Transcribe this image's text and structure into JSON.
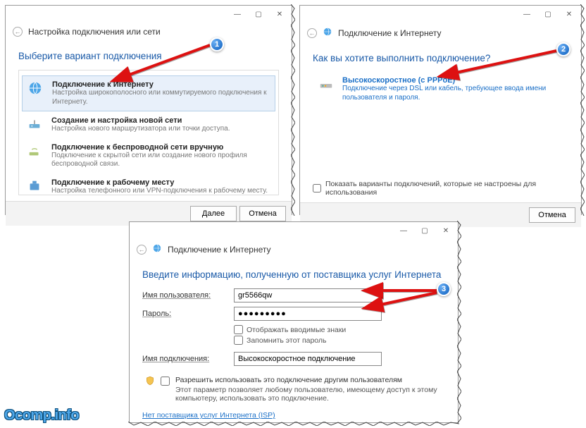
{
  "dialog1": {
    "title": "Настройка подключения или сети",
    "heading": "Выберите вариант подключения",
    "options": [
      {
        "title": "Подключение к Интернету",
        "desc": "Настройка широкополосного или коммутируемого подключения к Интернету."
      },
      {
        "title": "Создание и настройка новой сети",
        "desc": "Настройка нового маршрутизатора или точки доступа."
      },
      {
        "title": "Подключение к беспроводной сети вручную",
        "desc": "Подключение к скрытой сети или создание нового профиля беспроводной связи."
      },
      {
        "title": "Подключение к рабочему месту",
        "desc": "Настройка телефонного или VPN-подключения к рабочему месту."
      }
    ],
    "btn_next": "Далее",
    "btn_cancel": "Отмена"
  },
  "dialog2": {
    "title": "Подключение к Интернету",
    "heading": "Как вы хотите выполнить подключение?",
    "option_title": "Высокоскоростное (с PPPoE)",
    "option_desc": "Подключение через DSL или кабель, требующее ввода имени пользователя и пароля.",
    "show_all": "Показать варианты подключений, которые не настроены для использования",
    "btn_cancel": "Отмена"
  },
  "dialog3": {
    "title": "Подключение к Интернету",
    "heading": "Введите информацию, полученную от поставщика услуг Интернета",
    "label_user": "Имя пользователя:",
    "label_pass": "Пароль:",
    "label_conn": "Имя подключения:",
    "val_user": "gr5566qw",
    "val_pass": "●●●●●●●●●",
    "val_conn": "Высокоскоростное подключение",
    "chk_show": "Отображать вводимые знаки",
    "chk_remember": "Запомнить этот пароль",
    "chk_allow": "Разрешить использовать это подключение другим пользователям",
    "allow_desc": "Этот параметр позволяет любому пользователю, имеющему доступ к этому компьютеру, использовать это подключение.",
    "link_isp": "Нет поставщика услуг Интернета (ISP)"
  },
  "badges": {
    "b1": "1",
    "b2": "2",
    "b3": "3"
  },
  "logo": "Ocomp.info"
}
